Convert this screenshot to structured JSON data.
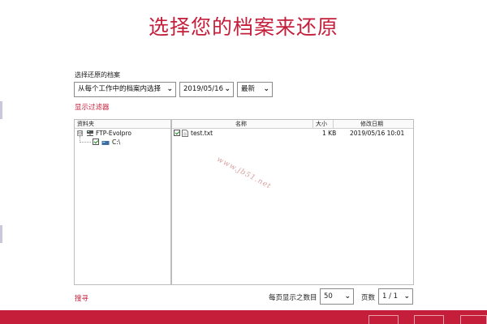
{
  "title": "选择您的档案来还原",
  "restore_section": {
    "label": "选择还原的档案",
    "source_select": "从每个工作中的档案内选择",
    "date_select": "2019/05/16",
    "version_select": "最新",
    "filter_link": "显示过滤器"
  },
  "tree": {
    "header": "资料夹",
    "root": {
      "expander": "⊟",
      "label": "FTP-Evolpro",
      "icon": "network-drive-icon"
    },
    "child": {
      "label": "C:\\",
      "icon": "drive-icon"
    }
  },
  "files": {
    "columns": [
      "名称",
      "大小",
      "修改日期"
    ],
    "rows": [
      {
        "name": "test.txt",
        "size": "1 KB",
        "modified": "2019/05/16 10:01",
        "icon": "text-file-icon"
      }
    ]
  },
  "watermark": "www.jb51.net",
  "footer": {
    "search_link": "搜寻",
    "per_page_label": "每页显示之数目",
    "per_page_value": "50",
    "page_label": "页数",
    "page_value": "1 / 1"
  },
  "colors": {
    "accent": "#c41e3a"
  }
}
